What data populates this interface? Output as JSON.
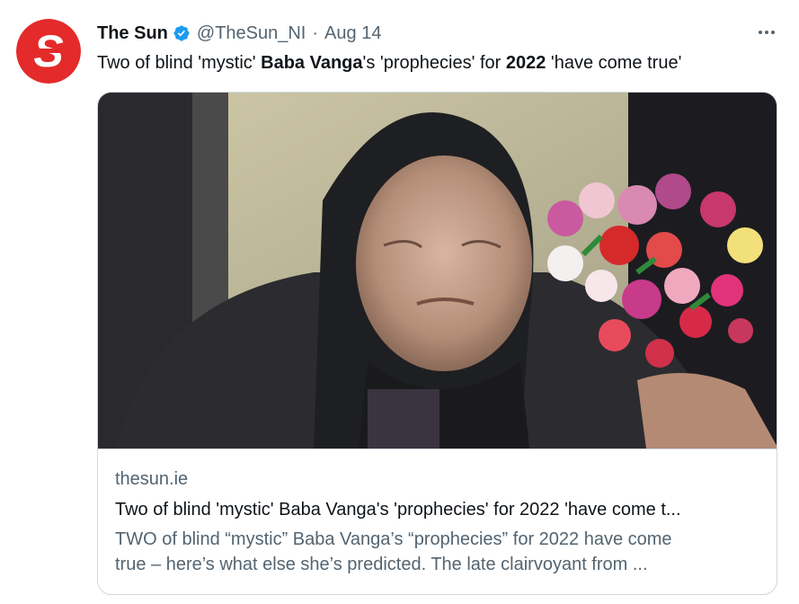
{
  "author": {
    "name": "The Sun",
    "handle": "@TheSun_NI",
    "separator": "·",
    "date": "Aug 14",
    "verified": true,
    "avatar_letter": "S",
    "avatar_color": "#e42a2a"
  },
  "tweet": {
    "text_parts": [
      {
        "text": "Two of blind 'mystic' ",
        "bold": false
      },
      {
        "text": "Baba Vanga",
        "bold": true
      },
      {
        "text": "'s 'prophecies' for ",
        "bold": false
      },
      {
        "text": "2022",
        "bold": true
      },
      {
        "text": " 'have come true'",
        "bold": false
      }
    ]
  },
  "card": {
    "domain": "thesun.ie",
    "title": "Two of blind 'mystic' Baba Vanga's 'prophecies' for 2022 'have come t...",
    "description_line1": "TWO of blind “mystic” Baba Vanga’s “prophecies” for 2022 have come",
    "description_line2": "true – here’s what else she’s predicted. The late clairvoyant from ..."
  },
  "colors": {
    "text": "#0f1419",
    "secondary": "#536471",
    "border": "#cfd9de",
    "verified": "#1d9bf0"
  },
  "icons": {
    "verified": "verified-badge-icon",
    "more": "more-options-icon"
  }
}
